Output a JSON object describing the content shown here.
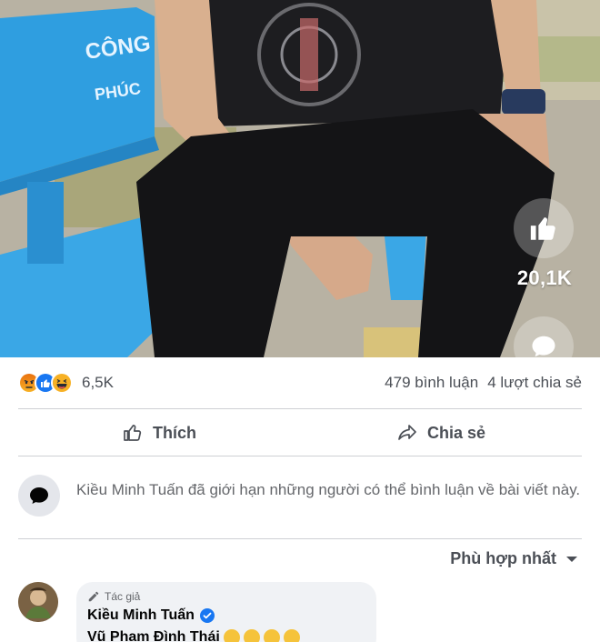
{
  "video": {
    "bench_text_line1": "CÔNG",
    "bench_text_line2": "PHÚC",
    "like_count": "20,1K"
  },
  "reactions": {
    "icons": [
      "angry-icon",
      "like-icon",
      "haha-icon"
    ],
    "count": "6,5K",
    "comments": "479 bình luận",
    "shares": "4 lượt chia sẻ"
  },
  "actions": {
    "like_label": "Thích",
    "share_label": "Chia sẻ"
  },
  "notice": {
    "text": "Kiều Minh Tuấn đã giới hạn những người có thể bình luận về bài viết này."
  },
  "sort": {
    "label": "Phù hợp nhất"
  },
  "comment": {
    "badge": "Tác giả",
    "author": "Kiều Minh Tuấn",
    "text": "Vũ Phạm Đình Thái"
  },
  "colors": {
    "accent": "#1877f2",
    "muted_text": "#65676b",
    "divider": "#ced0d4",
    "bench_blue": "#2f9ee0"
  }
}
